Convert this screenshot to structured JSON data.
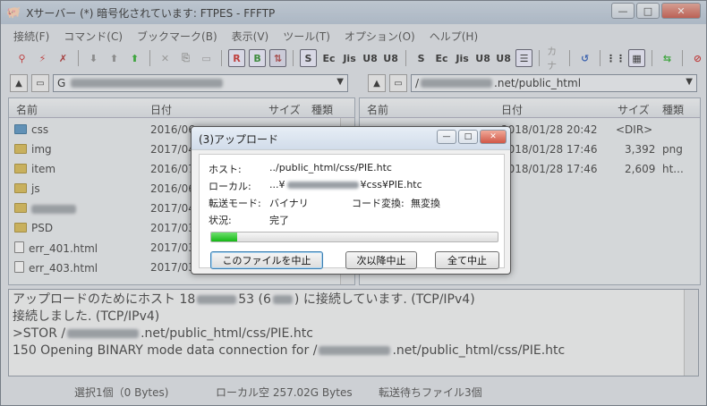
{
  "window": {
    "title": "Xサーバー (*) 暗号化されています: FTPES - FFFTP"
  },
  "menu": [
    "接続(F)",
    "コマンド(C)",
    "ブックマーク(B)",
    "表示(V)",
    "ツール(T)",
    "オプション(O)",
    "ヘルプ(H)"
  ],
  "toolbar": {
    "buttons": [
      "R",
      "B",
      "S",
      "Ec",
      "Jis",
      "U8",
      "U8",
      "S",
      "Ec",
      "Jis",
      "U8",
      "U8",
      "カナ"
    ]
  },
  "left_path": {
    "prefix": "G"
  },
  "right_path": {
    "value_prefix": "/",
    "value_suffix": ".net/public_html"
  },
  "left_pane": {
    "headers": {
      "name": "名前",
      "date": "日付",
      "size": "サイズ",
      "type": "種類"
    },
    "rows": [
      {
        "name": "css",
        "date": "2016/06"
      },
      {
        "name": "img",
        "date": "2017/04"
      },
      {
        "name": "item",
        "date": "2016/07"
      },
      {
        "name": "js",
        "date": "2016/06"
      },
      {
        "name": "",
        "date": "2017/04"
      },
      {
        "name": "PSD",
        "date": "2017/03"
      },
      {
        "name": "err_401.html",
        "date": "2017/03"
      },
      {
        "name": "err_403.html",
        "date": "2017/03"
      }
    ]
  },
  "right_pane": {
    "headers": {
      "name": "名前",
      "date": "日付",
      "size": "サイズ",
      "type": "種類"
    },
    "rows": [
      {
        "date": "2018/01/28 20:42",
        "size": "<DIR>",
        "type": ""
      },
      {
        "date": "2018/01/28 17:46",
        "size": "3,392",
        "type": "png"
      },
      {
        "date": "2018/01/28 17:46",
        "size": "2,609",
        "type": "ht..."
      }
    ]
  },
  "log": {
    "line1a": "アップロードのためにホスト 18",
    "line1b": "53 (6",
    "line1c": ") に接続しています. (TCP/IPv4)",
    "line2": "接続しました. (TCP/IPv4)",
    "line3a": ">STOR /",
    "line3b": ".net/public_html/css/PIE.htc",
    "line4a": "150 Opening BINARY mode data connection for /",
    "line4b": ".net/public_html/css/PIE.htc"
  },
  "status": {
    "selected": "選択1個（0 Bytes)",
    "local_free": "ローカル空 257.02G Bytes",
    "queue": "転送待ちファイル3個"
  },
  "dialog": {
    "title": "(3)アップロード",
    "host_label": "ホスト:",
    "host_value": "../public_html/css/PIE.htc",
    "local_label": "ローカル:",
    "local_prefix": "...¥",
    "local_suffix": "¥css¥PIE.htc",
    "mode_label": "転送モード:",
    "mode_value": "バイナリ",
    "code_label": "コード変換:",
    "code_value": "無変換",
    "state_label": "状況:",
    "state_value": "完了",
    "progress": 0.09,
    "btn_cancel_file": "このファイルを中止",
    "btn_cancel_rest": "次以降中止",
    "btn_cancel_all": "全て中止"
  }
}
